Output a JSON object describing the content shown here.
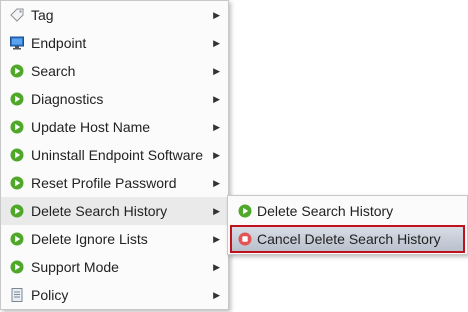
{
  "menu": {
    "items": [
      {
        "label": "Tag",
        "icon": "tag-icon"
      },
      {
        "label": "Endpoint",
        "icon": "monitor-icon"
      },
      {
        "label": "Search",
        "icon": "play-circle-icon"
      },
      {
        "label": "Diagnostics",
        "icon": "play-circle-icon"
      },
      {
        "label": "Update Host Name",
        "icon": "play-circle-icon"
      },
      {
        "label": "Uninstall Endpoint Software",
        "icon": "play-circle-icon"
      },
      {
        "label": "Reset Profile Password",
        "icon": "play-circle-icon"
      },
      {
        "label": "Delete Search History",
        "icon": "play-circle-icon"
      },
      {
        "label": "Delete Ignore Lists",
        "icon": "play-circle-icon"
      },
      {
        "label": "Support Mode",
        "icon": "play-circle-icon"
      },
      {
        "label": "Policy",
        "icon": "policy-document-icon"
      }
    ]
  },
  "submenu": {
    "items": [
      {
        "label": "Delete Search History",
        "icon": "play-circle-icon"
      },
      {
        "label": "Cancel Delete Search History",
        "icon": "stop-circle-icon"
      }
    ]
  },
  "colors": {
    "play_green": "#4fa82a",
    "stop_red": "#e35454",
    "highlight_border": "#c0121c"
  }
}
